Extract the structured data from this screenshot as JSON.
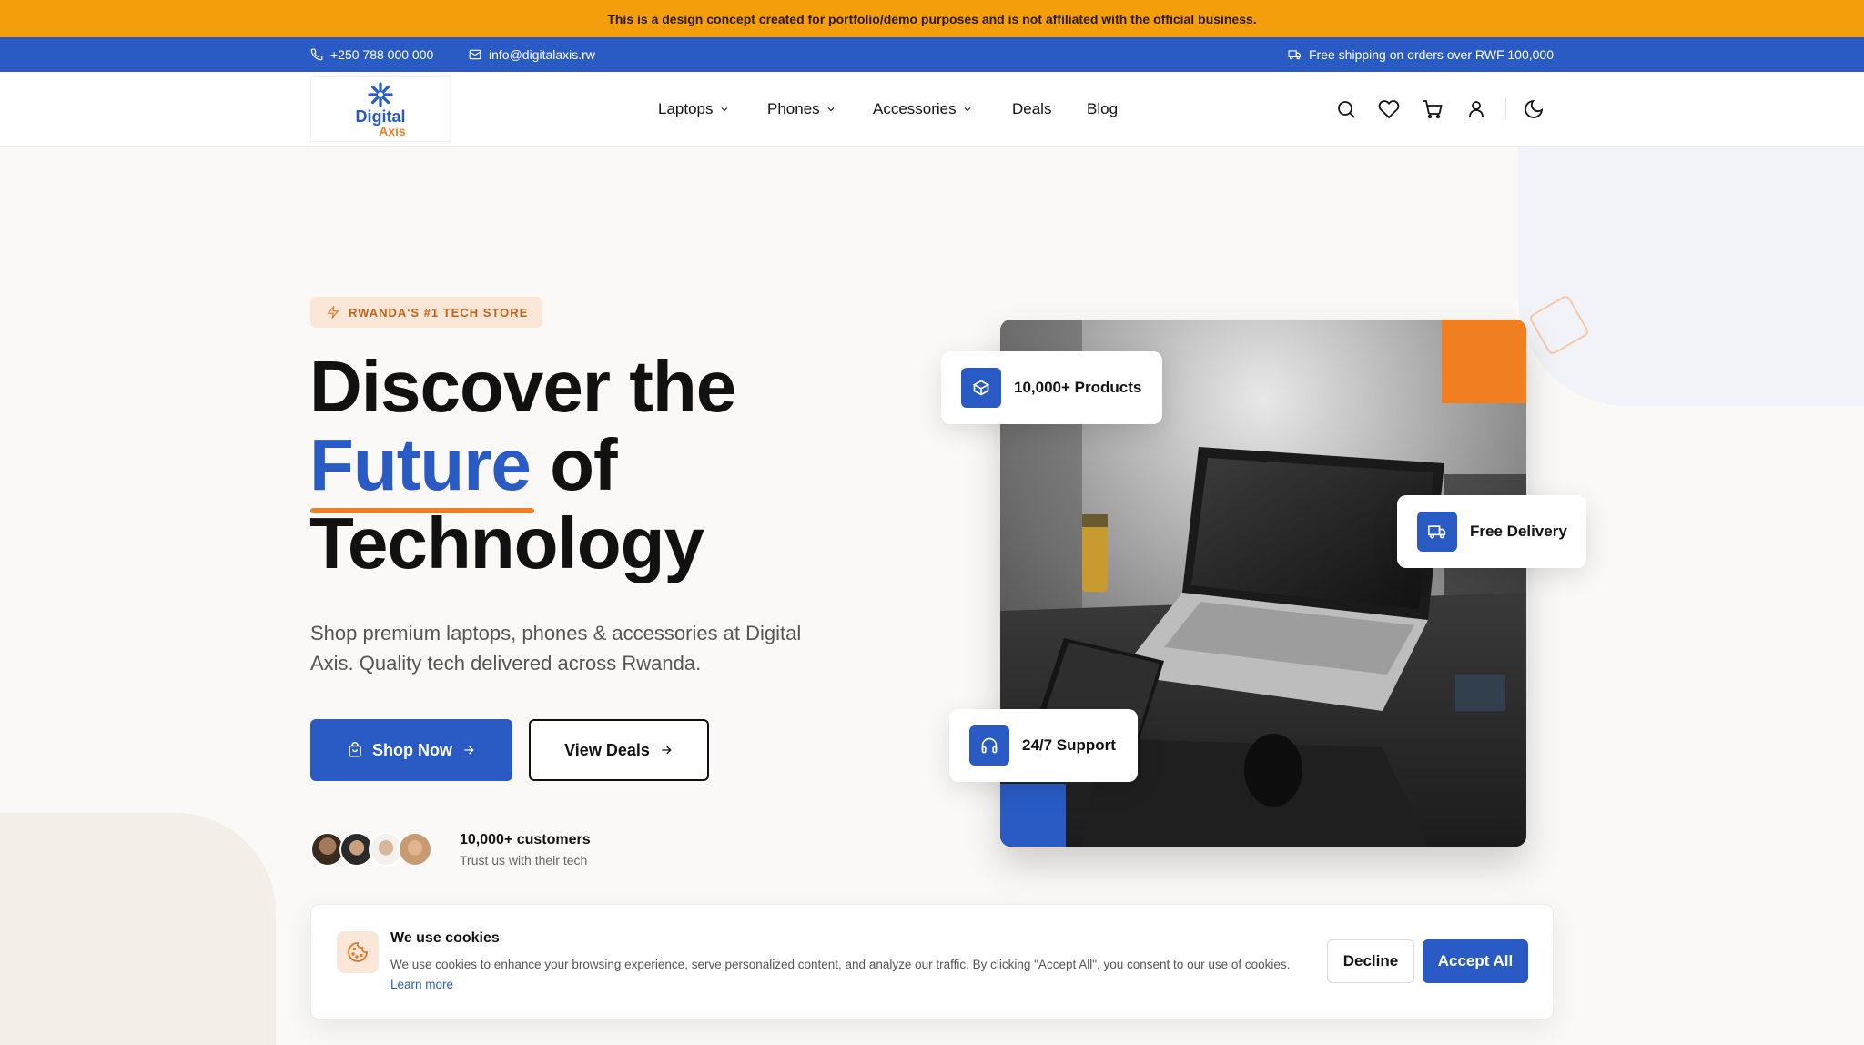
{
  "disclaimer": "This is a design concept created for portfolio/demo purposes and is not affiliated with the official business.",
  "topbar": {
    "phone": "+250 788 000 000",
    "email": "info@digitalaxis.rw",
    "shipping": "Free shipping on orders over RWF 100,000"
  },
  "logo": {
    "line1": "Digital",
    "line2": "Axis"
  },
  "nav": {
    "items": [
      {
        "label": "Laptops",
        "dropdown": true
      },
      {
        "label": "Phones",
        "dropdown": true
      },
      {
        "label": "Accessories",
        "dropdown": true
      },
      {
        "label": "Deals",
        "dropdown": false
      },
      {
        "label": "Blog",
        "dropdown": false
      }
    ]
  },
  "header_icons": [
    "search-icon",
    "heart-icon",
    "cart-icon",
    "user-icon",
    "moon-icon"
  ],
  "hero": {
    "badge": "RWANDA'S #1 TECH STORE",
    "headline_1": "Discover the",
    "headline_accent": "Future",
    "headline_2": " of",
    "headline_3": "Technology",
    "subtitle": "Shop premium laptops, phones & accessories at Digital Axis. Quality tech delivered across Rwanda.",
    "primary_cta": "Shop Now",
    "secondary_cta": "View Deals",
    "proof_title": "10,000+ customers",
    "proof_sub": "Trust us with their tech"
  },
  "float_cards": {
    "products": "10,000+ Products",
    "delivery": "Free Delivery",
    "support": "24/7 Support"
  },
  "cookie": {
    "title": "We use cookies",
    "text": "We use cookies to enhance your browsing experience, serve personalized content, and analyze our traffic. By clicking \"Accept All\", you consent to our use of cookies.",
    "link": "Learn more",
    "decline": "Decline",
    "accept": "Accept All"
  },
  "colors": {
    "brand_blue": "#2a5bc4",
    "brand_orange": "#f07f22",
    "disclaimer_bg": "#f59e0b"
  }
}
